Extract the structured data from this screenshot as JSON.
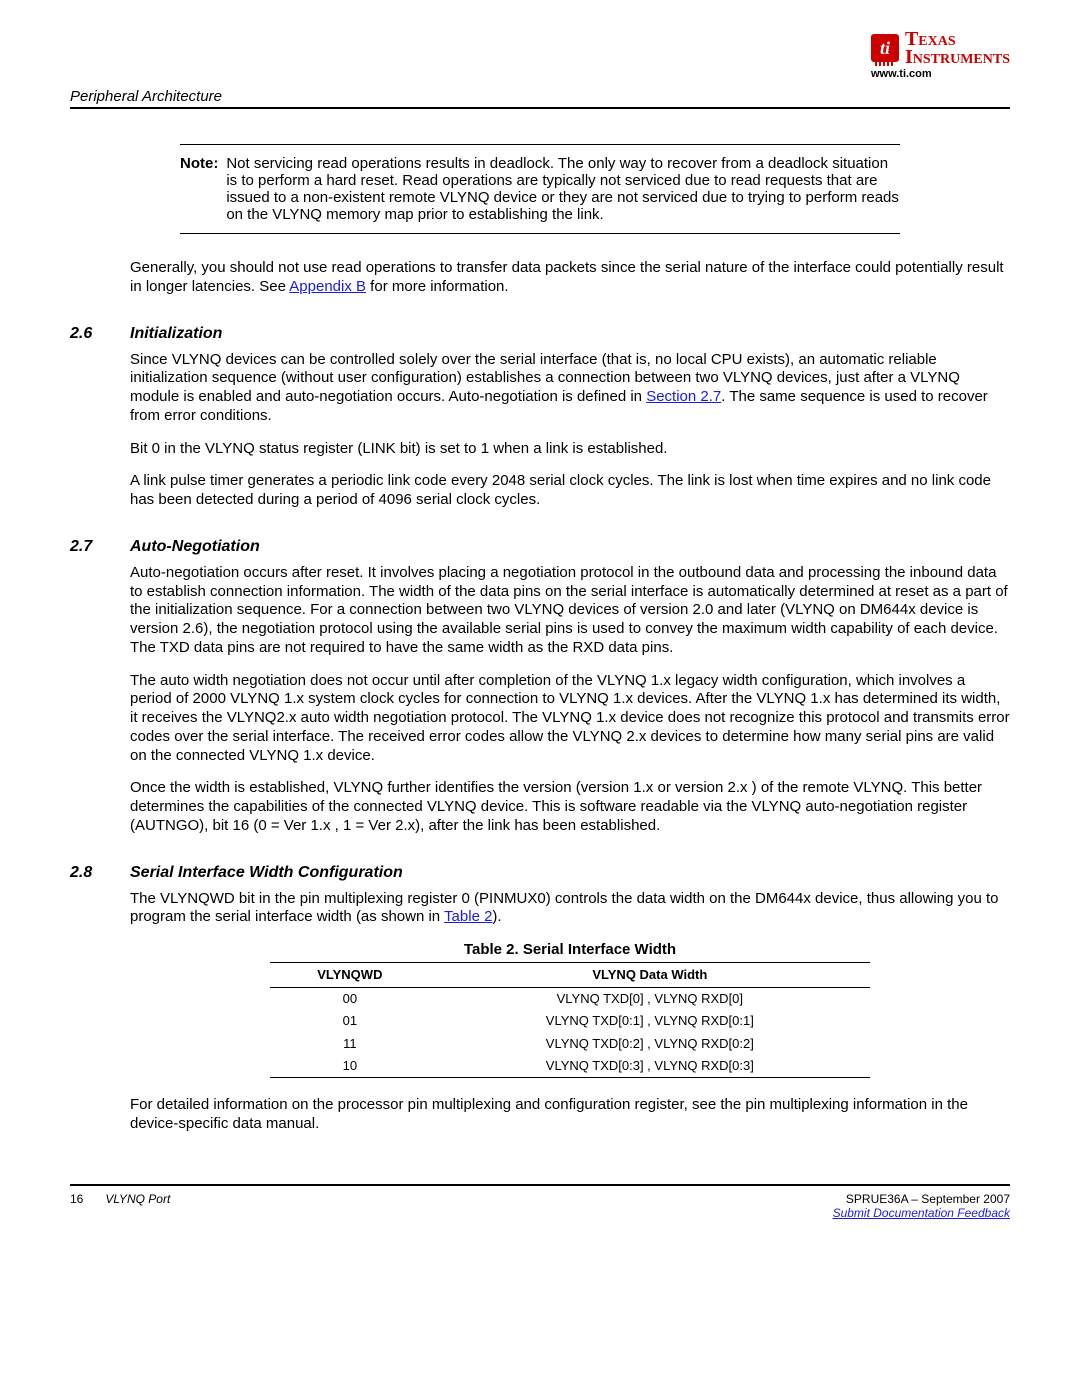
{
  "branding": {
    "line1": "Texas",
    "line2": "Instruments",
    "url": "www.ti.com",
    "chip_glyph": "ti"
  },
  "section_header": "Peripheral Architecture",
  "note": {
    "label": "Note:",
    "text": "Not servicing read operations results in deadlock. The only way to recover from a deadlock situation is to perform a hard reset. Read operations are typically not serviced due to read requests that are issued to a non-existent remote VLYNQ device or they are not serviced due to trying to perform reads on the VLYNQ memory map prior to establishing the link."
  },
  "intro": {
    "pre_link": "Generally, you should not use read operations to transfer data packets since the serial nature of the interface could potentially result in longer latencies. See ",
    "link": "Appendix B",
    "post_link": " for more information."
  },
  "sec26": {
    "num": "2.6",
    "head": "Initialization",
    "p1_pre": "Since VLYNQ devices can be controlled solely over the serial interface (that is, no local CPU exists), an automatic reliable initialization sequence (without user configuration) establishes a connection between two VLYNQ devices, just after a VLYNQ module is enabled and auto-negotiation occurs. Auto-negotiation is defined in ",
    "p1_link": "Section 2.7",
    "p1_post": ". The same sequence is used to recover from error conditions.",
    "p2": "Bit 0 in the VLYNQ status register (LINK bit) is set to 1 when a link is established.",
    "p3": "A link pulse timer generates a periodic link code every 2048 serial clock cycles. The link is lost when time expires and no link code has been detected during a period of 4096 serial clock cycles."
  },
  "sec27": {
    "num": "2.7",
    "head": "Auto-Negotiation",
    "p1": "Auto-negotiation occurs after reset. It involves placing a negotiation protocol in the outbound data and processing the inbound data to establish connection information. The width of the data pins on the serial interface is automatically determined at reset as a part of the initialization sequence. For a connection between two VLYNQ devices of version 2.0 and later (VLYNQ on DM644x device is version 2.6), the negotiation protocol using the available serial pins is used to convey the maximum width capability of each device. The TXD data pins are not required to have the same width as the RXD data pins.",
    "p2": "The auto width negotiation does not occur until after completion of the VLYNQ 1.x legacy width configuration, which involves a period of 2000 VLYNQ 1.x system clock cycles for connection to VLYNQ 1.x devices. After the VLYNQ 1.x has determined its width, it receives the VLYNQ2.x auto width negotiation protocol. The VLYNQ 1.x device does not recognize this protocol and transmits error codes over the serial interface. The received error codes allow the VLYNQ 2.x devices to determine how many serial pins are valid on the connected VLYNQ 1.x device.",
    "p3": "Once the width is established, VLYNQ further identifies the version (version 1.x or version 2.x ) of the remote VLYNQ. This better determines the capabilities of the connected VLYNQ device. This is software readable via the VLYNQ auto-negotiation register (AUTNGO), bit 16 (0 = Ver 1.x , 1 = Ver 2.x), after the link has been established."
  },
  "sec28": {
    "num": "2.8",
    "head": "Serial Interface Width Configuration",
    "p1_pre": "The VLYNQWD bit in the pin multiplexing register 0 (PINMUX0) controls the data width on the DM644x device, thus allowing you to program the serial interface width (as shown in ",
    "p1_link": "Table 2",
    "p1_post": ").",
    "p2": "For detailed information on the processor pin multiplexing and configuration register, see the pin multiplexing information in the device-specific data manual."
  },
  "table2": {
    "caption": "Table 2. Serial Interface Width",
    "col1": "VLYNQWD",
    "col2": "VLYNQ Data Width",
    "rows": [
      {
        "c1": "00",
        "c2": "VLYNQ TXD[0] , VLYNQ RXD[0]"
      },
      {
        "c1": "01",
        "c2": "VLYNQ TXD[0:1] , VLYNQ RXD[0:1]"
      },
      {
        "c1": "11",
        "c2": "VLYNQ TXD[0:2] , VLYNQ RXD[0:2]"
      },
      {
        "c1": "10",
        "c2": "VLYNQ TXD[0:3] , VLYNQ RXD[0:3]"
      }
    ]
  },
  "footer": {
    "page": "16",
    "doc_title": "VLYNQ Port",
    "doc_id": "SPRUE36A – September 2007",
    "feedback": "Submit Documentation Feedback"
  }
}
